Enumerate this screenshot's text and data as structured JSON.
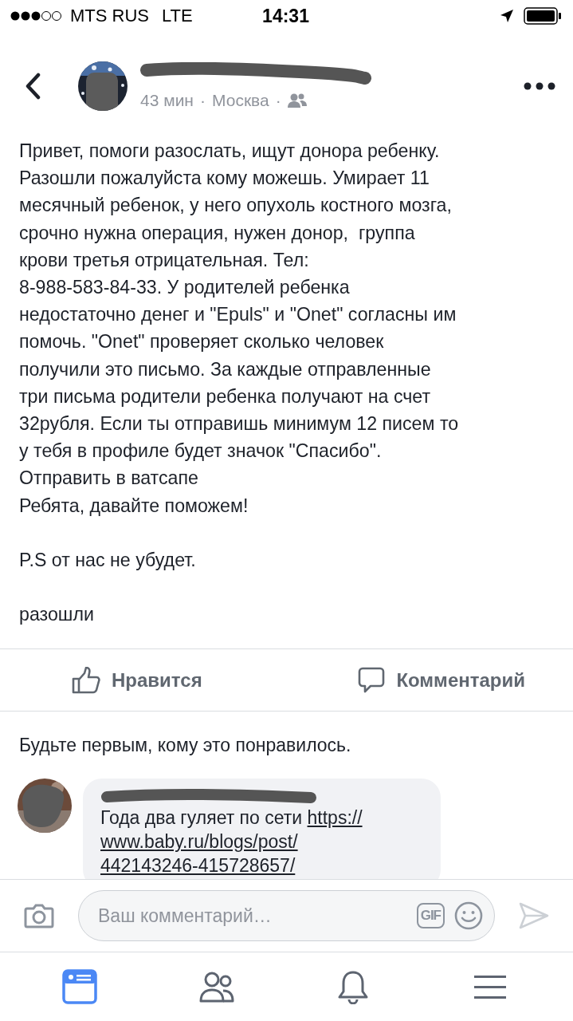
{
  "status_bar": {
    "carrier": "MTS RUS",
    "network": "LTE",
    "time": "14:31"
  },
  "post": {
    "meta": [
      "43 мин",
      "·",
      "Москва",
      "·"
    ],
    "text": "Привет, помоги разослать, ищут донора ребенку.\nРазошли пожалуйста кому можешь. Умирает 11\nмесячный ребенок, у него опухоль костного мозга,\nсрочно нужна операция, нужен донор,  группа\nкрови третья отрицательная. Тел:\n8-988-583-84-33. У родителей ребенка\nнедостаточно денег и \"Epuls\" и \"Onet\" согласны им\nпомочь. \"Onet\" проверяет сколько человек\nполучили это письмо. За каждые отправленные\nтри письма родители ребенка получают на счет\n32рубля. Если ты отправишь минимум 12 писем то\nу тебя в профиле будет значок \"Спасибо\".\nОтправить в ватсапе\nРебята, давайте поможем!\n\nP.S от нас не убудет.\n\nразошли"
  },
  "actions": [
    {
      "kind": "like",
      "label": "Нравится"
    },
    {
      "kind": "comment",
      "label": "Комментарий"
    }
  ],
  "likes_summary": "Будьте первым, кому это понравилось.",
  "comments": [
    {
      "text": "Года два гуляет по сети",
      "link": "https://\nwww.baby.ru/blogs/post/\n442143246-415728657/"
    }
  ],
  "comment_input": {
    "placeholder": "Ваш комментарий…",
    "gif_label": "GIF"
  },
  "tabs": [
    {
      "kind": "feed",
      "selected": true
    },
    {
      "kind": "friends",
      "selected": false
    },
    {
      "kind": "notifications",
      "selected": false
    },
    {
      "kind": "menu",
      "selected": false
    }
  ]
}
